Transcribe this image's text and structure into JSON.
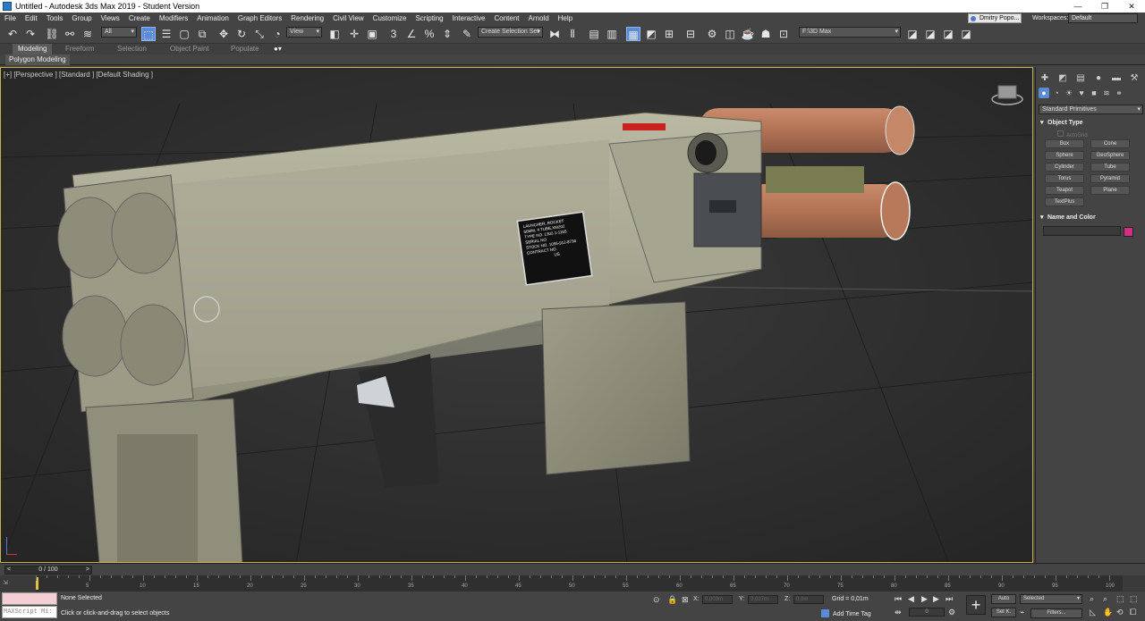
{
  "window": {
    "title": "Untitled - Autodesk 3ds Max 2019 - Student Version",
    "minimize": "—",
    "restore": "❐",
    "close": "✕"
  },
  "menu": [
    "File",
    "Edit",
    "Tools",
    "Group",
    "Views",
    "Create",
    "Modifiers",
    "Animation",
    "Graph Editors",
    "Rendering",
    "Civil View",
    "Customize",
    "Scripting",
    "Interactive",
    "Content",
    "Arnold",
    "Help"
  ],
  "user": "Dmitry Popo...",
  "workspaces_label": "Workspaces:",
  "workspace": "Default",
  "toolbar": {
    "filter": "All",
    "ref_coord": "View",
    "selection_set": "Create Selection Set",
    "path": "F:\\3D Max",
    "percent_icon": "%"
  },
  "ribbon": {
    "tabs": [
      "Modeling",
      "Freeform",
      "Selection",
      "Object Paint",
      "Populate"
    ],
    "sub": "Polygon Modeling"
  },
  "viewport": {
    "label": "[+] [Perspective ] [Standard ] [Default Shading ]",
    "plate": [
      "LAUNCHER, ROCKET",
      "66MM, 4 TUBE,XM202",
      "TYPE NO. 1302-1-1165",
      "SERIAL NO",
      "STOCK NO. 1055-912-8736",
      "CONTRACT NO.",
      "US"
    ]
  },
  "command_panel": {
    "dropdown": "Standard Primitives",
    "object_type": "Object Type",
    "autogrid": "AutoGrid",
    "buttons": [
      "Box",
      "Cone",
      "Sphere",
      "GeoSphere",
      "Cylinder",
      "Tube",
      "Torus",
      "Pyramid",
      "Teapot",
      "Plane",
      "TextPlus"
    ],
    "name_color": "Name and Color",
    "color": "#d12e84"
  },
  "timeline": {
    "frame": "0 / 100",
    "prev": "<",
    "next": ">",
    "ticks": [
      "5",
      "10",
      "15",
      "20",
      "25",
      "30",
      "35",
      "40",
      "45",
      "50",
      "55",
      "60",
      "65",
      "70",
      "75",
      "80",
      "85",
      "90",
      "95",
      "100"
    ],
    "current": 0
  },
  "status": {
    "selection": "None Selected",
    "prompt": "Click or click-and-drag to select objects",
    "maxscript": "MAXScript Mi:",
    "x_label": "X:",
    "x": "0,003m",
    "y_label": "Y:",
    "y": "0,027m",
    "z_label": "Z:",
    "z": "0,0m",
    "grid": "Grid = 0,01m",
    "add_time_tag": "Add Time Tag",
    "auto": "Auto",
    "set_key": "Set K.",
    "selected": "Selected",
    "filters": "Filters...",
    "frame_field": "0"
  }
}
